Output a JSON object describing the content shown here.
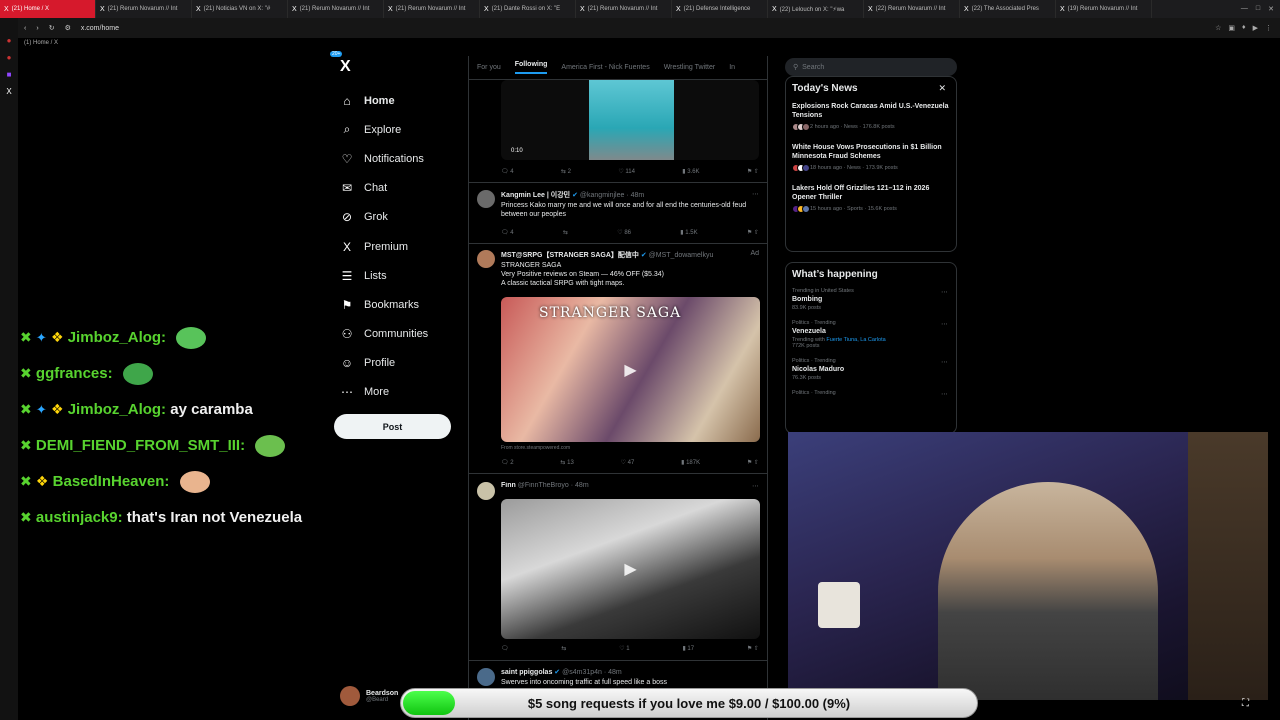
{
  "browser": {
    "tabs": [
      {
        "label": "(21) Home / X",
        "active": true
      },
      {
        "label": "(21) Rerum Novarum // Int"
      },
      {
        "label": "(21) Noticias VN on X: \"#"
      },
      {
        "label": "(21) Rerum Novarum // Int"
      },
      {
        "label": "(21) Rerum Novarum // Int"
      },
      {
        "label": "(21) Dante Rossi on X: \"E"
      },
      {
        "label": "(21) Rerum Novarum // Int"
      },
      {
        "label": "(21) Defense Intelligence"
      },
      {
        "label": "(22) Lelouch on X: \"⚡wa"
      },
      {
        "label": "(22) Rerum Novarum // Int"
      },
      {
        "label": "(22) The Associated Pres"
      },
      {
        "label": "(19) Rerum Novarum // Int"
      }
    ],
    "url": "x.com/home",
    "subtitle": "(1) Home / X"
  },
  "nav": {
    "logo": "X",
    "items": [
      {
        "label": "Home",
        "icon": "home-icon",
        "glyph": "⌂"
      },
      {
        "label": "Explore",
        "icon": "search-icon",
        "glyph": "⌕"
      },
      {
        "label": "Notifications",
        "icon": "bell-icon",
        "glyph": "♡",
        "badge": "20+"
      },
      {
        "label": "Chat",
        "icon": "mail-icon",
        "glyph": "✉"
      },
      {
        "label": "Grok",
        "icon": "grok-icon",
        "glyph": "⊘"
      },
      {
        "label": "Premium",
        "icon": "x-premium-icon",
        "glyph": "X"
      },
      {
        "label": "Lists",
        "icon": "lists-icon",
        "glyph": "☰"
      },
      {
        "label": "Bookmarks",
        "icon": "bookmark-icon",
        "glyph": "⚑"
      },
      {
        "label": "Communities",
        "icon": "communities-icon",
        "glyph": "⚇"
      },
      {
        "label": "Profile",
        "icon": "profile-icon",
        "glyph": "☺"
      },
      {
        "label": "More",
        "icon": "more-icon",
        "glyph": "⋯"
      }
    ],
    "post_label": "Post",
    "account_name": "Beardson",
    "account_handle": "@Beard"
  },
  "timeline": {
    "tabs": [
      "For you",
      "Following",
      "America First - Nick Fuentes",
      "Wrestling Twitter",
      "In"
    ],
    "tweet1": {
      "duration": "0:10",
      "replies": "4",
      "reposts": "2",
      "likes": "114",
      "views": "3.6K"
    },
    "tweet2": {
      "name": "Kangmin Lee | 이강민",
      "handle": "@kangminjlee · 48m",
      "text": "Princess Kako marry me and we will once and for all end the centuries-old feud between our peoples",
      "replies": "4",
      "reposts": "",
      "likes": "86",
      "views": "1.5K"
    },
    "tweet3": {
      "name": "MST@SRPG【STRANGER SAGA】配信中",
      "handle": "@MST_dowamelkyu",
      "ad": "Ad",
      "text_lines": [
        "STRANGER SAGA",
        "Very Positive reviews on Steam — 46% OFF ($5.34)",
        "A classic tactical SRPG with tight maps."
      ],
      "media_title": "STRANGER SAGA",
      "from": "From store.steampowered.com",
      "replies": "2",
      "reposts": "13",
      "likes": "47",
      "views": "187K"
    },
    "tweet4": {
      "name": "Finn",
      "handle": "@FinnTheBroyo · 48m",
      "replies": "",
      "reposts": "",
      "likes": "1",
      "views": "17"
    },
    "tweet5": {
      "name": "saint ppiggolas",
      "handle": "@s4m31p4n · 48m",
      "text": "Swerves into oncoming traffic at full speed like a boss"
    }
  },
  "sidebar": {
    "search_placeholder": "Search",
    "news_title": "Today's News",
    "news": [
      {
        "title": "Explosions Rock Caracas Amid U.S.-Venezuela Tensions",
        "meta": "2 hours ago · News · 176.8K posts"
      },
      {
        "title": "White House Vows Prosecutions in $1 Billion Minnesota Fraud Schemes",
        "meta": "18 hours ago · News · 173.9K posts"
      },
      {
        "title": "Lakers Hold Off Grizzlies 121–112 in 2026 Opener Thriller",
        "meta": "15 hours ago · Sports · 15.6K posts"
      }
    ],
    "happening_title": "What’s happening",
    "trends": [
      {
        "cat": "Trending in United States",
        "name": "Bombing",
        "posts": "83.9K posts"
      },
      {
        "cat": "Politics · Trending",
        "name": "Venezuela",
        "with_prefix": "Trending with",
        "with": "Fuerte Tiuna, La Carlota",
        "posts": "772K posts"
      },
      {
        "cat": "Politics · Trending",
        "name": "Nicolas Maduro",
        "posts": "76.3K posts"
      },
      {
        "cat": "Politics · Trending",
        "name": "",
        "posts": ""
      }
    ]
  },
  "chat": [
    {
      "user": "Jimboz_Alog:",
      "text": "",
      "badges": "mod-sword-verified"
    },
    {
      "user": "ggfrances:",
      "text": ""
    },
    {
      "user": "Jimboz_Alog:",
      "text": "ay caramba",
      "badges": "mod-sword-verified"
    },
    {
      "user": "DEMI_FIEND_FROM_SMT_III:",
      "text": ""
    },
    {
      "user": "BasedInHeaven:",
      "text": "",
      "badges": "verified"
    },
    {
      "user": "austinjack9:",
      "text": "that's Iran not Venezuela"
    }
  ],
  "donation": {
    "text": "$5 song requests if you love me $9.00 / $100.00 (9%)",
    "progress": 0.09
  }
}
